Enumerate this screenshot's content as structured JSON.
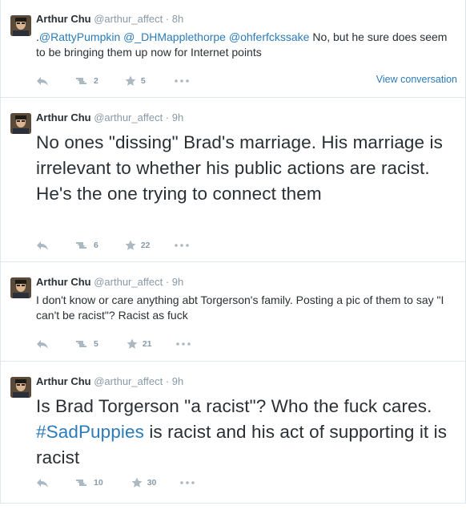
{
  "colors": {
    "link": "#2b7bb9",
    "meta": "#8899a6",
    "icon": "#aab8c2",
    "text": "#292f33"
  },
  "tweets": [
    {
      "fullname": "Arthur Chu",
      "username": "@arthur_affect",
      "separator": "·",
      "time": "8h",
      "text_prefix": ".",
      "mentions": "@RattyPumpkin @_DHMapplethorpe @ohferfckssake",
      "text_body": " No, but he sure does seem to be bringing them up now for Internet points",
      "retweets": "2",
      "favorites": "5",
      "view_conversation": "View conversation",
      "icons": [
        "reply-icon",
        "retweet-icon",
        "favorite-star-icon",
        "more-icon"
      ]
    },
    {
      "fullname": "Arthur Chu",
      "username": "@arthur_affect",
      "separator": "·",
      "time": "9h",
      "text": "No ones \"dissing\" Brad's marriage. His marriage is irrelevant to whether his public actions are racist. He's the one trying to connect them",
      "retweets": "6",
      "favorites": "22"
    },
    {
      "fullname": "Arthur Chu",
      "username": "@arthur_affect",
      "separator": "·",
      "time": "9h",
      "text": "I don't know or care anything abt Torgerson's family. Posting a pic of them to say \"I can't be racist\"? Racist as fuck",
      "retweets": "5",
      "favorites": "21"
    },
    {
      "fullname": "Arthur Chu",
      "username": "@arthur_affect",
      "separator": "·",
      "time": "9h",
      "text_before": "Is Brad Torgerson \"a racist\"? Who the fuck cares. ",
      "hashtag": "#SadPuppies",
      "text_after": " is racist and his act of supporting it is racist",
      "retweets": "10",
      "favorites": "30"
    }
  ]
}
